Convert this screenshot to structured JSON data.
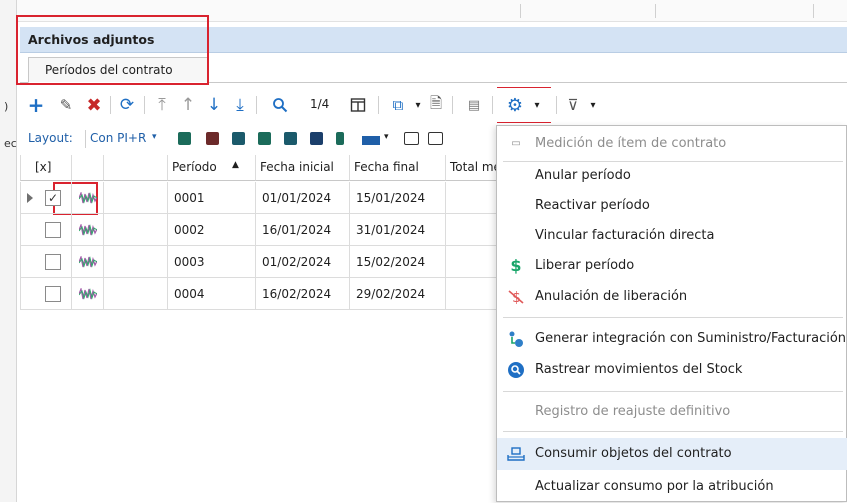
{
  "section": {
    "title": "Archivos adjuntos"
  },
  "tab": {
    "label": "Períodos del contrato"
  },
  "toolbar": {
    "page_info": "1/4"
  },
  "layout": {
    "label": "Layout:",
    "value": "Con PI+R"
  },
  "grid": {
    "headers": [
      "[x]",
      "Período",
      "Fecha inicial",
      "Fecha final",
      "Total me"
    ],
    "rows": [
      {
        "checked": true,
        "period": "0001",
        "start": "01/01/2024",
        "end": "15/01/2024"
      },
      {
        "checked": false,
        "period": "0002",
        "start": "16/01/2024",
        "end": "31/01/2024"
      },
      {
        "checked": false,
        "period": "0003",
        "start": "01/02/2024",
        "end": "15/02/2024"
      },
      {
        "checked": false,
        "period": "0004",
        "start": "16/02/2024",
        "end": "29/02/2024"
      }
    ]
  },
  "menu": {
    "items": [
      {
        "label": "Medición de ítem de contrato",
        "icon": "measure-icon",
        "disabled": true
      },
      {
        "label": "Anular período",
        "icon": "",
        "disabled": false
      },
      {
        "label": "Reactivar período",
        "icon": "",
        "disabled": false
      },
      {
        "label": "Vincular facturación directa",
        "icon": "",
        "disabled": false
      },
      {
        "label": "Liberar período",
        "icon": "dollar-icon",
        "disabled": false
      },
      {
        "label": "Anulación de liberación",
        "icon": "dollar-cancel-icon",
        "disabled": false
      },
      {
        "label": "Generar integración con Suministro/Facturación",
        "icon": "integration-icon",
        "disabled": false
      },
      {
        "label": "Rastrear movimientos del Stock",
        "icon": "track-icon",
        "disabled": false
      },
      {
        "label": "Registro de reajuste definitivo",
        "icon": "",
        "disabled": true
      },
      {
        "label": "Consumir objetos del contrato",
        "icon": "consume-icon",
        "disabled": false
      },
      {
        "label": "Actualizar consumo por la atribución",
        "icon": "",
        "disabled": false
      }
    ]
  },
  "colors": {
    "accent_red": "#d9232f",
    "header_blue": "#d4e3f4",
    "link_blue": "#1f5fa8",
    "dollar_green": "#1aa56a"
  }
}
